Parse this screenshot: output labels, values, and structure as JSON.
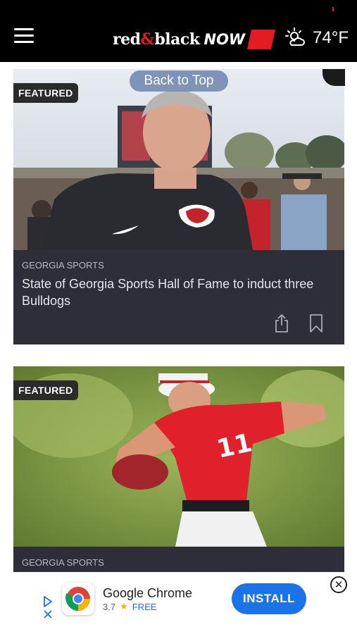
{
  "header": {
    "menu_icon": "hamburger-menu-icon",
    "logo": {
      "part1": "red",
      "amp": "&",
      "part2": "black",
      "now": "NOW"
    },
    "weather": {
      "icon": "partly-sunny-icon",
      "temperature": "74°F"
    }
  },
  "back_to_top": "Back to Top",
  "cards": [
    {
      "badge": "FEATURED",
      "category": "GEORGIA SPORTS",
      "headline": "State of Georgia Sports Hall of Fame to induct three Bulldogs",
      "image": "coach-portrait-photo"
    },
    {
      "badge": "FEATURED",
      "category": "GEORGIA SPORTS",
      "headline": "",
      "image": "baseball-pitcher-photo"
    }
  ],
  "ad": {
    "app_name": "Google Chrome",
    "rating": "3.7",
    "price": "FREE",
    "cta": "INSTALL"
  },
  "colors": {
    "header_bg": "#000000",
    "brand_red": "#e31b23",
    "card_bg": "#2e2e38",
    "install_blue": "#1a73e8",
    "back_to_top_bg": "#7a8fb5"
  }
}
